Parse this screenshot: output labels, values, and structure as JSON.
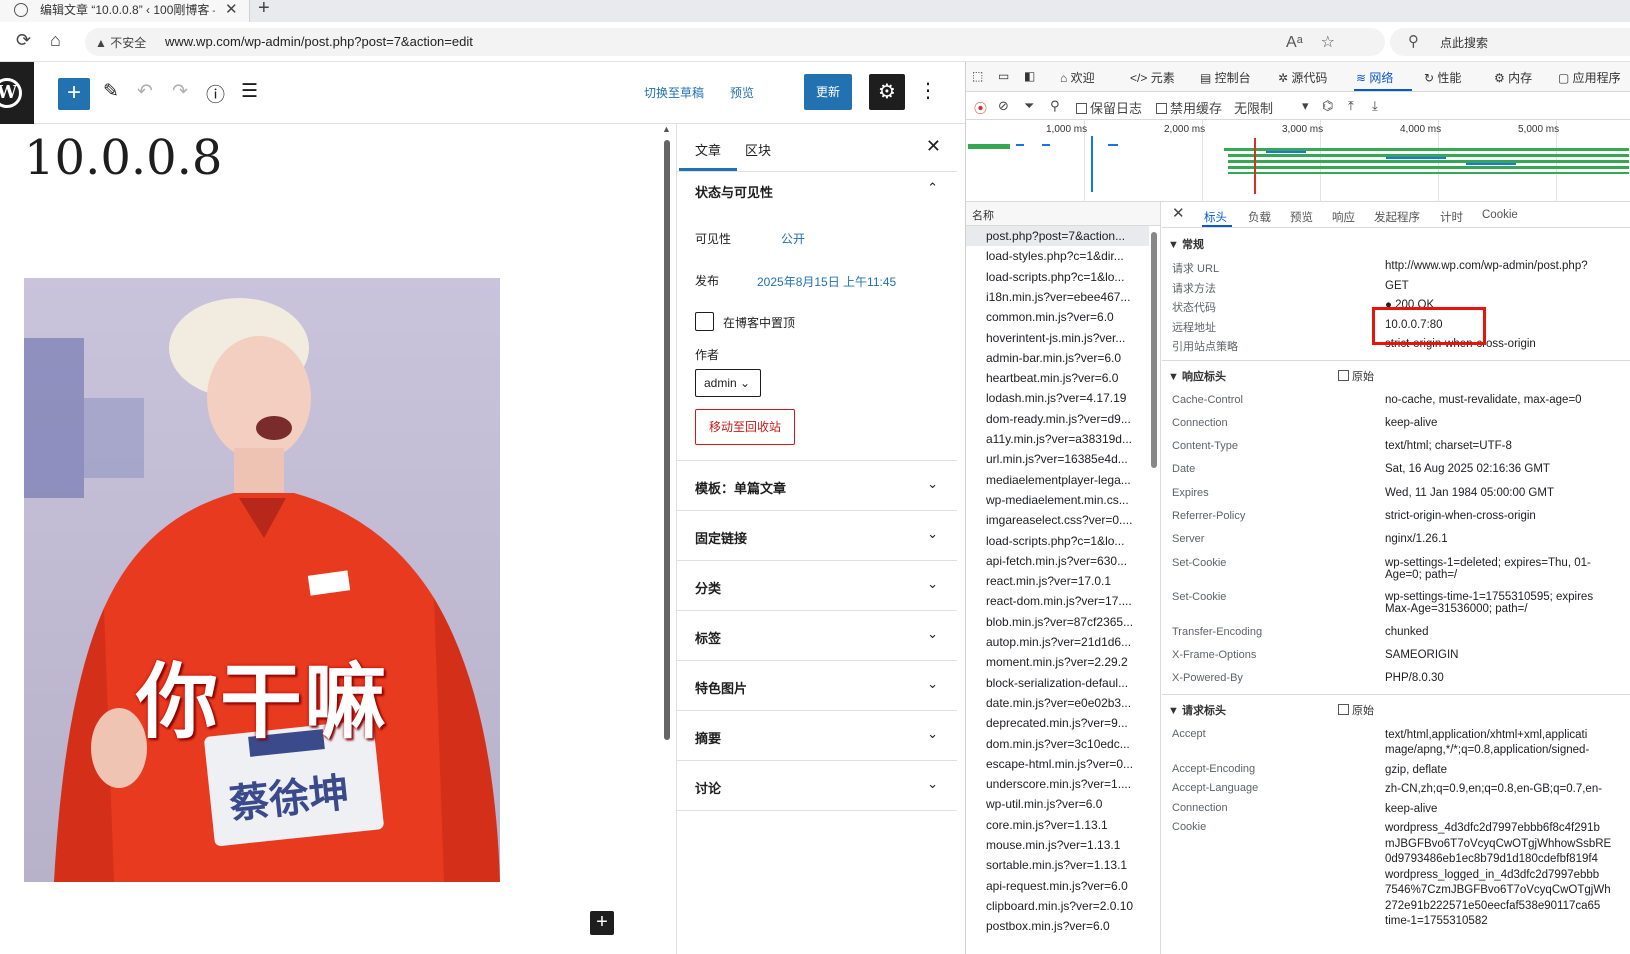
{
  "browser": {
    "tab_title": "编辑文章 “10.0.0.8” ‹ 100剛博客 —",
    "tab_close": "✕",
    "new_tab": "+",
    "insecure_label": "▲ 不安全",
    "url": "www.wp.com/wp-admin/post.php?post=7&action=edit",
    "search_placeholder": "点此搜索"
  },
  "editor": {
    "switch_draft": "切换至草稿",
    "preview": "预览",
    "update": "更新",
    "post_title": "10.0.0.8",
    "image_caption": "你干嘛",
    "image_badge": "蔡徐坤"
  },
  "sidebar": {
    "tab_post": "文章",
    "tab_block": "区块",
    "status_section": "状态与可见性",
    "visibility_label": "可见性",
    "visibility_value": "公开",
    "publish_label": "发布",
    "publish_value": "2025年8月15日 上午11:45",
    "sticky_label": "在博客中置顶",
    "author_label": "作者",
    "author_value": "admin",
    "trash_button": "移动至回收站",
    "panels": [
      "模板：单篇文章",
      "固定链接",
      "分类",
      "标签",
      "特色图片",
      "摘要",
      "讨论"
    ]
  },
  "devtools": {
    "tabs": [
      "欢迎",
      "元素",
      "控制台",
      "源代码",
      "网络",
      "性能",
      "内存",
      "应用程序"
    ],
    "active_tab": "网络",
    "toolbar": {
      "preserve_log": "保留日志",
      "disable_cache": "禁用缓存",
      "throttle": "无限制"
    },
    "timeline_labels": [
      "1,000 ms",
      "2,000 ms",
      "3,000 ms",
      "4,000 ms",
      "5,000 ms"
    ],
    "name_header": "名称",
    "requests": [
      "post.php?post=7&action...",
      "load-styles.php?c=1&dir...",
      "load-scripts.php?c=1&lo...",
      "i18n.min.js?ver=ebee467...",
      "common.min.js?ver=6.0",
      "hoverintent-js.min.js?ver...",
      "admin-bar.min.js?ver=6.0",
      "heartbeat.min.js?ver=6.0",
      "lodash.min.js?ver=4.17.19",
      "dom-ready.min.js?ver=d9...",
      "a11y.min.js?ver=a38319d...",
      "url.min.js?ver=16385e4d...",
      "mediaelementplayer-lega...",
      "wp-mediaelement.min.cs...",
      "imgareaselect.css?ver=0....",
      "load-scripts.php?c=1&lo...",
      "api-fetch.min.js?ver=630...",
      "react.min.js?ver=17.0.1",
      "react-dom.min.js?ver=17....",
      "blob.min.js?ver=87cf2365...",
      "autop.min.js?ver=21d1d6...",
      "moment.min.js?ver=2.29.2",
      "block-serialization-defaul...",
      "date.min.js?ver=e0e02b3...",
      "deprecated.min.js?ver=9...",
      "dom.min.js?ver=3c10edc...",
      "escape-html.min.js?ver=0...",
      "underscore.min.js?ver=1....",
      "wp-util.min.js?ver=6.0",
      "core.min.js?ver=1.13.1",
      "mouse.min.js?ver=1.13.1",
      "sortable.min.js?ver=1.13.1",
      "api-request.min.js?ver=6.0",
      "clipboard.min.js?ver=2.0.10",
      "postbox.min.js?ver=6.0"
    ],
    "detail_tabs": [
      "标头",
      "负载",
      "预览",
      "响应",
      "发起程序",
      "计时",
      "Cookie"
    ],
    "general_header": "▼ 常规",
    "general": [
      {
        "k": "请求 URL",
        "v": "http://www.wp.com/wp-admin/post.php?"
      },
      {
        "k": "请求方法",
        "v": "GET"
      },
      {
        "k": "状态代码",
        "v": "● 200 OK"
      },
      {
        "k": "远程地址",
        "v": "10.0.0.7:80"
      },
      {
        "k": "引用站点策略",
        "v": "strict-origin-when-cross-origin"
      }
    ],
    "response_header": "▼ 响应标头",
    "raw_label": "原始",
    "response": [
      {
        "k": "Cache-Control",
        "v": "no-cache, must-revalidate, max-age=0"
      },
      {
        "k": "Connection",
        "v": "keep-alive"
      },
      {
        "k": "Content-Type",
        "v": "text/html; charset=UTF-8"
      },
      {
        "k": "Date",
        "v": "Sat, 16 Aug 2025 02:16:36 GMT"
      },
      {
        "k": "Expires",
        "v": "Wed, 11 Jan 1984 05:00:00 GMT"
      },
      {
        "k": "Referrer-Policy",
        "v": "strict-origin-when-cross-origin"
      },
      {
        "k": "Server",
        "v": "nginx/1.26.1"
      },
      {
        "k": "Set-Cookie",
        "v": "wp-settings-1=deleted; expires=Thu, 01-\nAge=0; path=/"
      },
      {
        "k": "Set-Cookie",
        "v": "wp-settings-time-1=1755310595; expires\nMax-Age=31536000; path=/"
      },
      {
        "k": "Transfer-Encoding",
        "v": "chunked"
      },
      {
        "k": "X-Frame-Options",
        "v": "SAMEORIGIN"
      },
      {
        "k": "X-Powered-By",
        "v": "PHP/8.0.30"
      }
    ],
    "request_header": "▼ 请求标头",
    "request": [
      {
        "k": "Accept",
        "v": "text/html,application/xhtml+xml,applicati\nmage/apng,*/*;q=0.8,application/signed-"
      },
      {
        "k": "Accept-Encoding",
        "v": "gzip, deflate"
      },
      {
        "k": "Accept-Language",
        "v": "zh-CN,zh;q=0.9,en;q=0.8,en-GB;q=0.7,en-"
      },
      {
        "k": "Connection",
        "v": "keep-alive"
      },
      {
        "k": "Cookie",
        "v": "wordpress_4d3dfc2d7997ebbb6f8c4f291b\nmJBGFBvo6T7oVcyqCwOTgjWhhowSsbRE\n0d9793486eb1ec8b79d1d180cdefbf819f4\nwordpress_logged_in_4d3dfc2d7997ebbb\n7546%7CzmJBGFBvo6T7oVcyqCwOTgjWh\n272e91b222571e50eecfaf538e90117ca65\ntime-1=1755310582"
      }
    ]
  }
}
